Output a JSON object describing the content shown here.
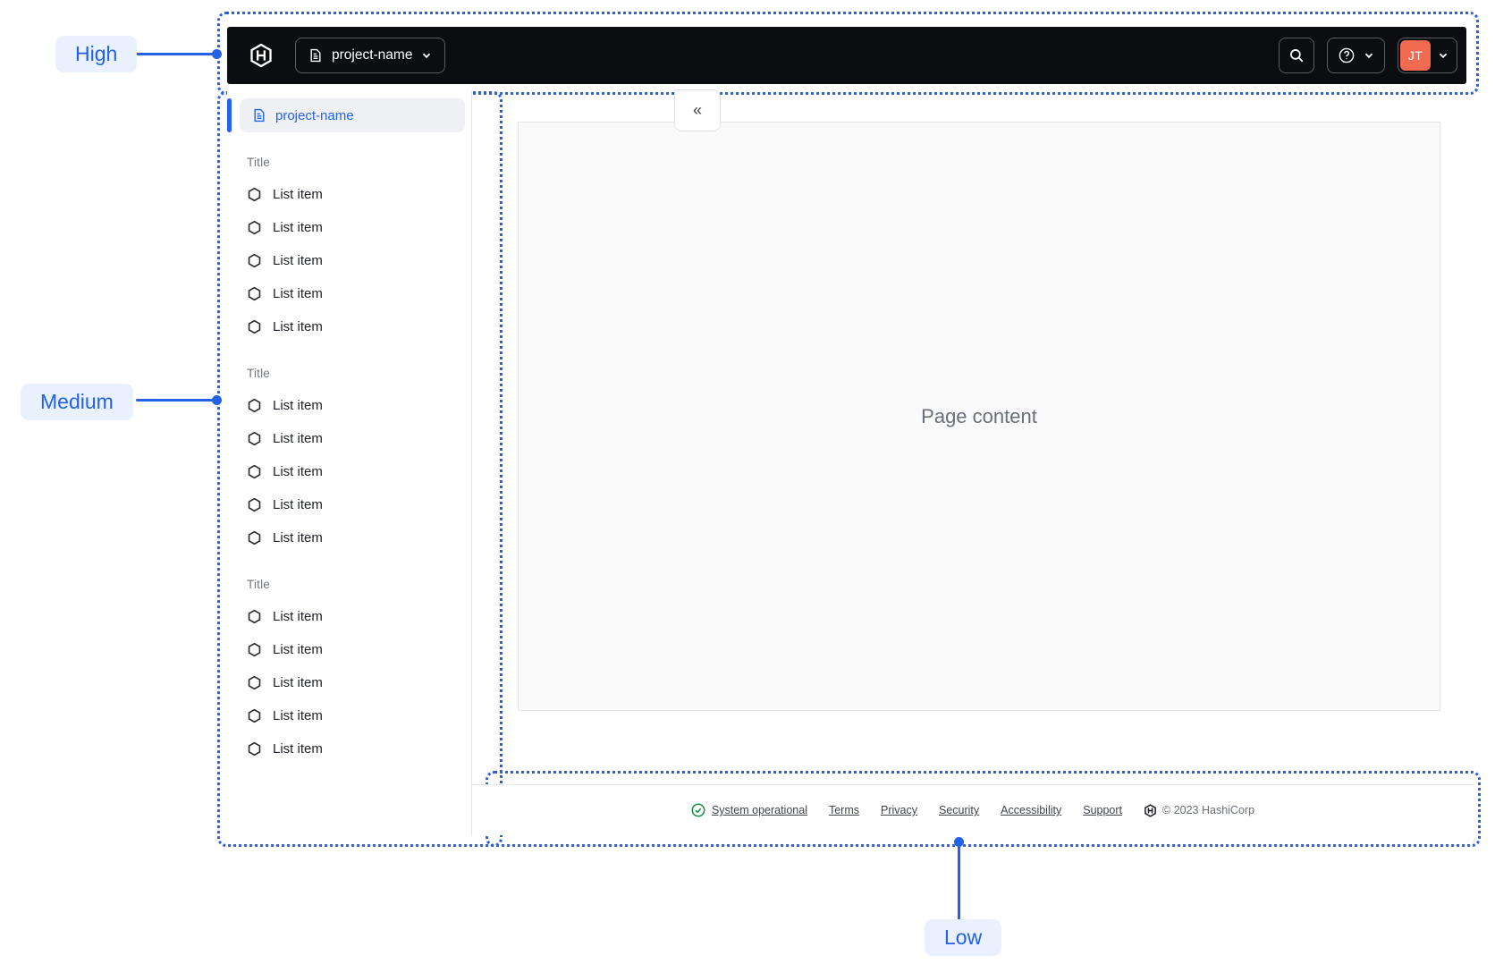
{
  "annotations": {
    "high": "High",
    "medium": "Medium",
    "low": "Low"
  },
  "navbar": {
    "project_switcher_label": "project-name",
    "user_initials": "JT"
  },
  "sidebar": {
    "header_label": "project-name",
    "collapse_icon": "«",
    "sections": [
      {
        "title": "Title",
        "items": [
          "List item",
          "List item",
          "List item",
          "List item",
          "List item"
        ]
      },
      {
        "title": "Title",
        "items": [
          "List item",
          "List item",
          "List item",
          "List item",
          "List item"
        ]
      },
      {
        "title": "Title",
        "items": [
          "List item",
          "List item",
          "List item",
          "List item",
          "List item"
        ]
      }
    ]
  },
  "main": {
    "placeholder": "Page content"
  },
  "footer": {
    "status": "System operational",
    "links": [
      "Terms",
      "Privacy",
      "Security",
      "Accessibility",
      "Support"
    ],
    "copyright": "© 2023 HashiCorp"
  },
  "colors": {
    "annotation_blue": "#2361E9",
    "navbar_bg": "#0C0D10",
    "avatar_orange": "#F26A50",
    "selected_blue": "#2563EB",
    "status_green": "#0E8E3E"
  }
}
